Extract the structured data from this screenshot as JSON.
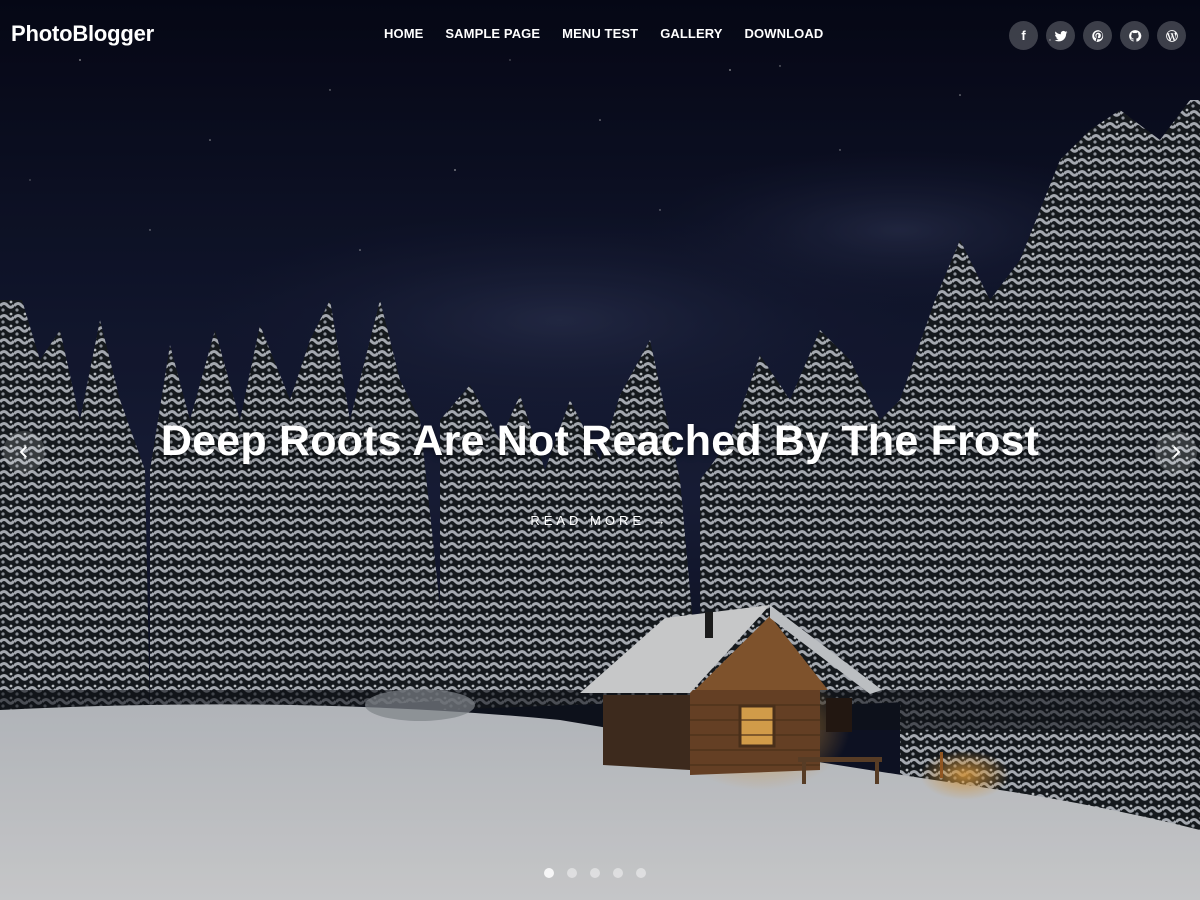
{
  "site": {
    "logo": "PhotoBlogger"
  },
  "nav": {
    "items": [
      {
        "label": "HOME"
      },
      {
        "label": "SAMPLE PAGE"
      },
      {
        "label": "MENU TEST"
      },
      {
        "label": "GALLERY"
      },
      {
        "label": "DOWNLOAD"
      }
    ]
  },
  "social": [
    {
      "icon": "facebook-icon",
      "glyph": "f"
    },
    {
      "icon": "twitter-icon"
    },
    {
      "icon": "pinterest-icon"
    },
    {
      "icon": "github-icon"
    },
    {
      "icon": "wordpress-icon"
    }
  ],
  "slider": {
    "title": "Deep Roots Are Not Reached By The Frost",
    "read_more": "READ MORE →",
    "slide_count": 5,
    "active_slide": 1
  },
  "colors": {
    "sky": "#0d1226",
    "snow": "#e8ebef",
    "cabin_light": "#ffb347",
    "text": "#ffffff"
  }
}
